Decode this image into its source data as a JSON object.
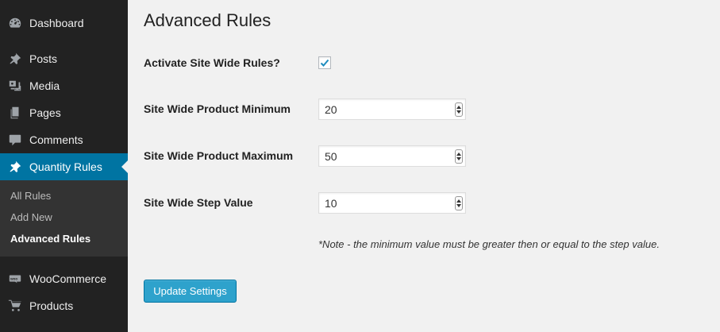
{
  "sidebar": {
    "items": [
      {
        "label": "Dashboard",
        "icon": "dashboard-icon"
      },
      {
        "label": "Posts",
        "icon": "pin-icon"
      },
      {
        "label": "Media",
        "icon": "media-icon"
      },
      {
        "label": "Pages",
        "icon": "pages-icon"
      },
      {
        "label": "Comments",
        "icon": "comment-icon"
      },
      {
        "label": "Quantity Rules",
        "icon": "pin-icon",
        "active": true
      },
      {
        "label": "WooCommerce",
        "icon": "woo-icon"
      },
      {
        "label": "Products",
        "icon": "cart-icon"
      }
    ],
    "submenu": [
      "All Rules",
      "Add New",
      "Advanced Rules"
    ],
    "submenu_current": "Advanced Rules"
  },
  "main": {
    "title": "Advanced Rules",
    "activate_label": "Activate Site Wide Rules?",
    "activate_checked": true,
    "min_label": "Site Wide Product Minimum",
    "min_value": "20",
    "max_label": "Site Wide Product Maximum",
    "max_value": "50",
    "step_label": "Site Wide Step Value",
    "step_value": "10",
    "note": "*Note - the minimum value must be greater then or equal to the step value.",
    "button_label": "Update Settings"
  },
  "colors": {
    "sidebar_bg": "#222222",
    "active_bg": "#0074a2",
    "button_bg": "#2ea2cc",
    "checkmark": "#1e8cbe"
  }
}
